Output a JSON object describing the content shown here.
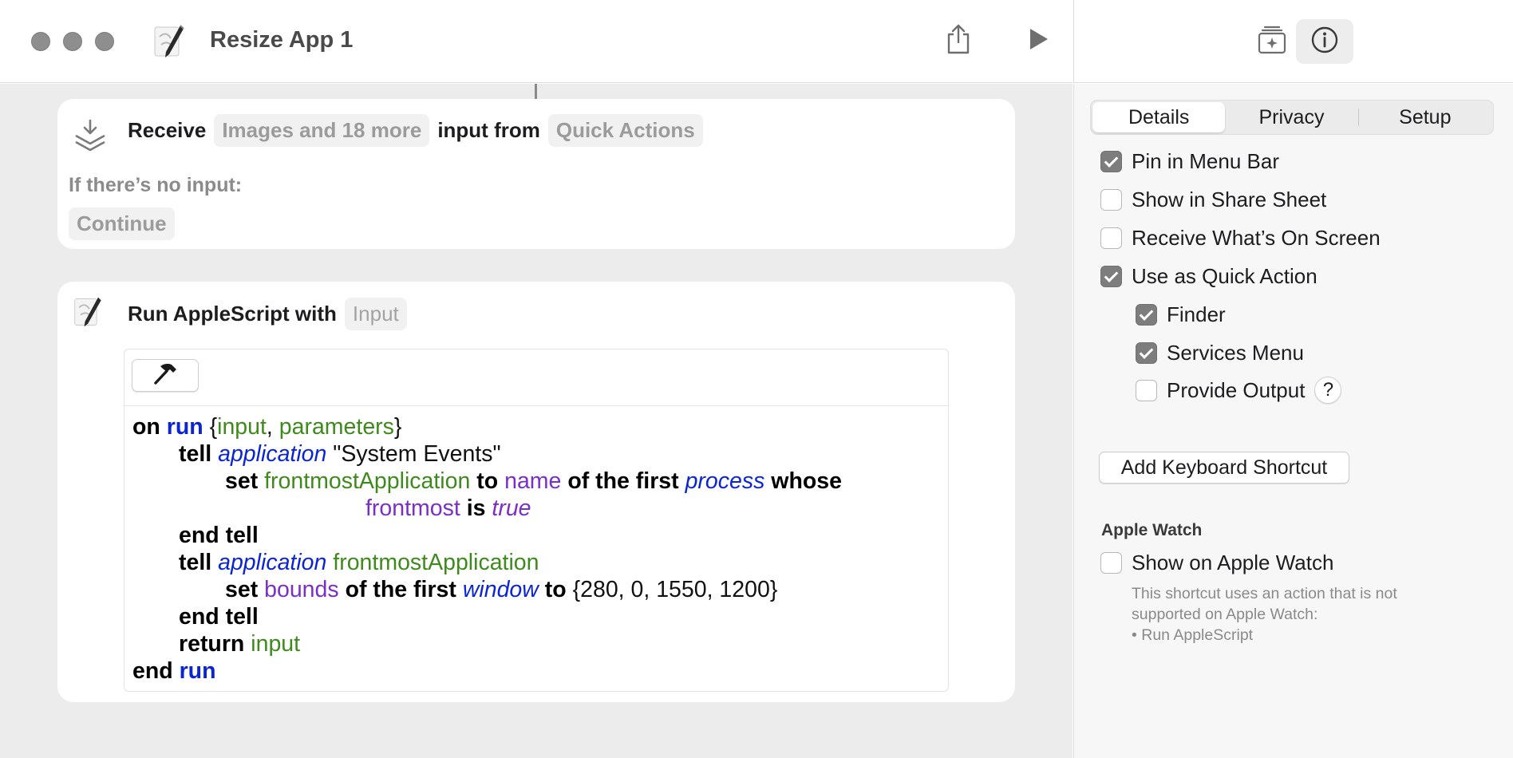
{
  "window": {
    "title": "Resize App 1",
    "icons": {
      "app": "script-editor-icon",
      "share": "share-icon",
      "run": "play-icon"
    }
  },
  "side_toolbar": {
    "icons": [
      "action-library-icon",
      "info-icon"
    ],
    "active": "info-icon"
  },
  "receive_action": {
    "verb": "Receive",
    "types": "Images and 18 more",
    "middle": "input from",
    "source": "Quick Actions",
    "no_input_label": "If there’s no input:",
    "no_input_value": "Continue"
  },
  "applescript_action": {
    "label": "Run AppleScript with",
    "param": "Input",
    "code": {
      "l1": {
        "on": "on",
        "run": "run",
        "open": " {",
        "input": "input",
        "comma": ", ",
        "params": "parameters",
        "close": "}"
      },
      "l2": {
        "tell": "tell",
        "application": "application",
        "target": " \"System Events\""
      },
      "l3": {
        "set": "set",
        "var": "frontmostApplication",
        "to": "to",
        "name": "name",
        "of": "of the first",
        "process": "process",
        "whose": "whose"
      },
      "l4": {
        "frontmost": "frontmost",
        "is": "is",
        "true": "true"
      },
      "l5": {
        "end": "end tell"
      },
      "l6": {
        "tell": "tell",
        "application": "application",
        "var": "frontmostApplication"
      },
      "l7": {
        "set": "set",
        "bounds": "bounds",
        "of": "of the first",
        "window": "window",
        "to": "to",
        "value": " {280, 0, 1550, 1200}"
      },
      "l8": {
        "end": "end tell"
      },
      "l9": {
        "return": "return",
        "input": "input"
      },
      "l10": {
        "end": "end",
        "run": "run"
      }
    }
  },
  "panel": {
    "tabs": [
      "Details",
      "Privacy",
      "Setup"
    ],
    "active_tab": "Details",
    "options": {
      "pin_menu_bar": {
        "label": "Pin in Menu Bar",
        "checked": true
      },
      "share_sheet": {
        "label": "Show in Share Sheet",
        "checked": false
      },
      "receive_screen": {
        "label": "Receive What’s On Screen",
        "checked": false
      },
      "quick_action": {
        "label": "Use as Quick Action",
        "checked": true
      },
      "finder": {
        "label": "Finder",
        "checked": true
      },
      "services_menu": {
        "label": "Services Menu",
        "checked": true
      },
      "provide_output": {
        "label": "Provide Output",
        "checked": false,
        "help": "?"
      }
    },
    "keyboard_shortcut_label": "Add Keyboard Shortcut",
    "apple_watch": {
      "title": "Apple Watch",
      "option": {
        "label": "Show on Apple Watch",
        "checked": false
      },
      "note_line1": "This shortcut uses an action that is not",
      "note_line2": "supported on Apple Watch:",
      "note_line3": "• Run AppleScript"
    }
  },
  "colors": {
    "keyword_blue": "#0b25d6",
    "variable_green": "#3f8a1c",
    "property_purple": "#7a2fc8",
    "editor_bg": "#ececec",
    "checkbox_on": "#7d7d7d"
  }
}
